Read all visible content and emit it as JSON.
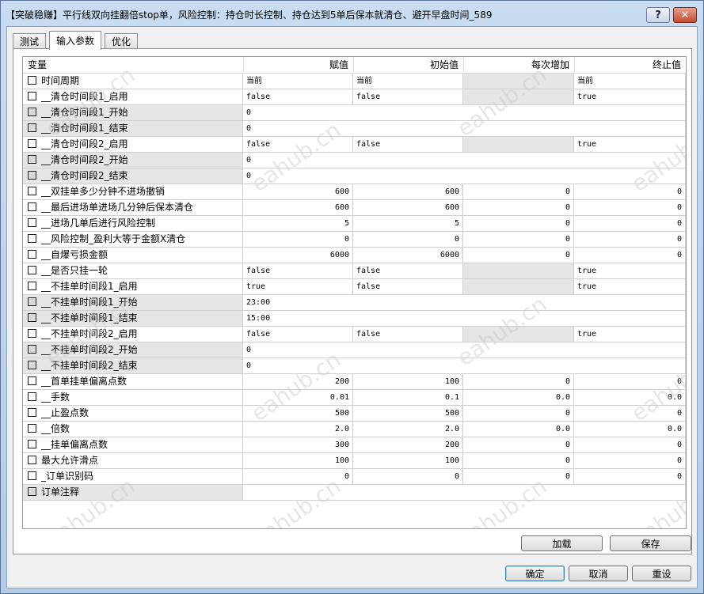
{
  "window": {
    "title": "【突破稳赚】平行线双向挂翻倍stop单，风险控制：持仓时长控制、持仓达到5单后保本就清仓、避开早盘时间_589",
    "help_label": "?",
    "close_label": "✕"
  },
  "tabs": [
    {
      "label": "测试"
    },
    {
      "label": "输入参数"
    },
    {
      "label": "优化"
    }
  ],
  "table": {
    "columns": [
      "变量",
      "赋值",
      "初始值",
      "每次增加",
      "终止值"
    ],
    "rows": [
      {
        "name": "时间周期",
        "value": "当前",
        "start": "当前",
        "step": "",
        "stop": "当前",
        "kind": "txt"
      },
      {
        "name": "__清仓时间段1_启用",
        "value": "false",
        "start": "false",
        "step": "",
        "stop": "true",
        "kind": "txt"
      },
      {
        "name": "__清仓时间段1_开始",
        "value": "0",
        "kind": "wide"
      },
      {
        "name": "__清仓时间段1_结束",
        "value": "0",
        "kind": "wide"
      },
      {
        "name": "__清仓时间段2_启用",
        "value": "false",
        "start": "false",
        "step": "",
        "stop": "true",
        "kind": "txt"
      },
      {
        "name": "__清仓时间段2_开始",
        "value": "0",
        "kind": "wide"
      },
      {
        "name": "__清仓时间段2_结束",
        "value": "0",
        "kind": "wide"
      },
      {
        "name": "__双挂单多少分钟不进场撤销",
        "value": "600",
        "start": "600",
        "step": "0",
        "stop": "0",
        "kind": "num"
      },
      {
        "name": "__最后进场单进场几分钟后保本清仓",
        "value": "600",
        "start": "600",
        "step": "0",
        "stop": "0",
        "kind": "num"
      },
      {
        "name": "__进场几单后进行风险控制",
        "value": "5",
        "start": "5",
        "step": "0",
        "stop": "0",
        "kind": "num"
      },
      {
        "name": "__风险控制_盈利大等于金额X清仓",
        "value": "0",
        "start": "0",
        "step": "0",
        "stop": "0",
        "kind": "num"
      },
      {
        "name": "__自爆亏损金额",
        "value": "6000",
        "start": "6000",
        "step": "0",
        "stop": "0",
        "kind": "num"
      },
      {
        "name": "__是否只挂一轮",
        "value": "false",
        "start": "false",
        "step": "",
        "stop": "true",
        "kind": "txt"
      },
      {
        "name": "__不挂单时间段1_启用",
        "value": "true",
        "start": "false",
        "step": "",
        "stop": "true",
        "kind": "txt"
      },
      {
        "name": "__不挂单时间段1_开始",
        "value": "23:00",
        "kind": "wide"
      },
      {
        "name": "__不挂单时间段1_结束",
        "value": "15:00",
        "kind": "wide"
      },
      {
        "name": "__不挂单时间段2_启用",
        "value": "false",
        "start": "false",
        "step": "",
        "stop": "true",
        "kind": "txt"
      },
      {
        "name": "__不挂单时间段2_开始",
        "value": "0",
        "kind": "wide"
      },
      {
        "name": "__不挂单时间段2_结束",
        "value": "0",
        "kind": "wide"
      },
      {
        "name": "__首单挂单偏离点数",
        "value": "200",
        "start": "100",
        "step": "0",
        "stop": "0",
        "kind": "num"
      },
      {
        "name": "__手数",
        "value": "0.01",
        "start": "0.1",
        "step": "0.0",
        "stop": "0.0",
        "kind": "num"
      },
      {
        "name": "__止盈点数",
        "value": "500",
        "start": "500",
        "step": "0",
        "stop": "0",
        "kind": "num"
      },
      {
        "name": "__倍数",
        "value": "2.0",
        "start": "2.0",
        "step": "0.0",
        "stop": "0.0",
        "kind": "num"
      },
      {
        "name": "__挂单偏离点数",
        "value": "300",
        "start": "200",
        "step": "0",
        "stop": "0",
        "kind": "num"
      },
      {
        "name": "最大允许滑点",
        "value": "100",
        "start": "100",
        "step": "0",
        "stop": "0",
        "kind": "num"
      },
      {
        "name": "_订单识别码",
        "value": "0",
        "start": "0",
        "step": "0",
        "stop": "0",
        "kind": "num"
      },
      {
        "name": "订单注释",
        "value": "",
        "kind": "wide"
      }
    ]
  },
  "buttons": {
    "load": "加载",
    "save": "保存",
    "ok": "确定",
    "cancel": "取消",
    "reset": "重设"
  },
  "watermark": "eahub.cn"
}
